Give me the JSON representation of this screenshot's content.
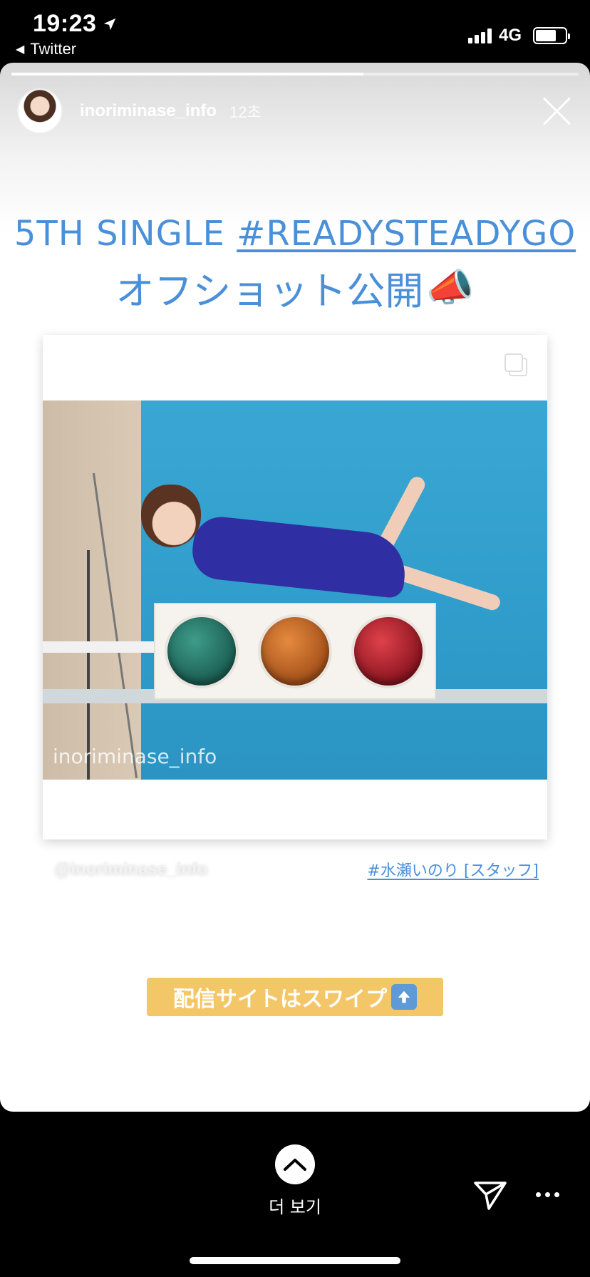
{
  "status_bar": {
    "time": "19:23",
    "back_app": "Twitter",
    "network": "4G",
    "battery_level": 0.7,
    "icons": [
      "location-arrow-icon",
      "signal-bars-icon",
      "battery-icon"
    ]
  },
  "story": {
    "progress": 0.62,
    "username": "inoriminase_info",
    "age": "12초",
    "close_icon": "close-icon"
  },
  "headline": {
    "line1_prefix": "5TH SINGLE ",
    "line1_tag": "#READYSTEADYGO",
    "line2": "オフショット公開",
    "line2_emoji": "📣"
  },
  "post": {
    "multi_icon": "carousel-icon",
    "watermark": "inoriminase_info"
  },
  "credits": {
    "left": "@inoriminase_info",
    "right": "#水瀬いのり [スタッフ]"
  },
  "swipe_banner": {
    "text": "配信サイトはスワイプ",
    "icon": "up-arrow-icon"
  },
  "bottom": {
    "see_more_label": "더 보기",
    "send_icon": "send-icon",
    "more_icon": "more-dots-icon"
  },
  "colors": {
    "accent_blue": "#4a90d9",
    "banner_yellow": "#f3c667"
  }
}
